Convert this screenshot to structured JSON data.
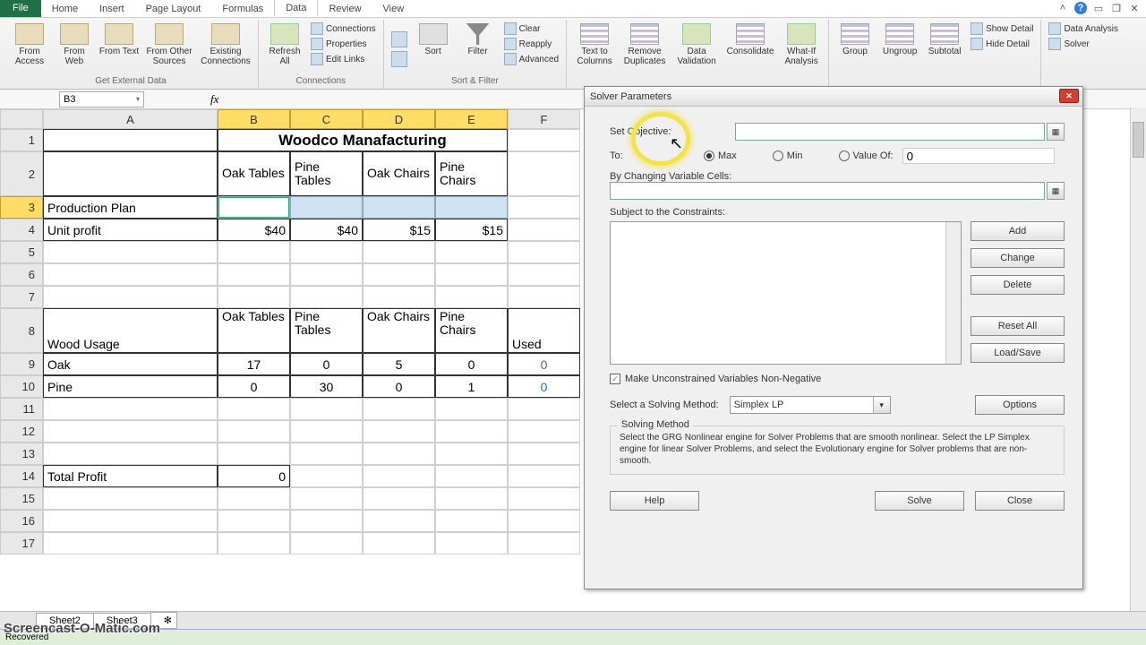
{
  "tabs": {
    "file": "File",
    "home": "Home",
    "insert": "Insert",
    "pagelayout": "Page Layout",
    "formulas": "Formulas",
    "data": "Data",
    "review": "Review",
    "view": "View"
  },
  "ribbon": {
    "ext": {
      "access": "From Access",
      "web": "From Web",
      "text": "From Text",
      "other": "From Other Sources",
      "existing": "Existing Connections",
      "group": "Get External Data"
    },
    "conn": {
      "refresh": "Refresh All",
      "connections": "Connections",
      "properties": "Properties",
      "editlinks": "Edit Links",
      "group": "Connections"
    },
    "sort": {
      "sort": "Sort",
      "filter": "Filter",
      "clear": "Clear",
      "reapply": "Reapply",
      "advanced": "Advanced",
      "group": "Sort & Filter"
    },
    "tools": {
      "ttc": "Text to Columns",
      "rmdup": "Remove Duplicates",
      "dvalid": "Data Validation",
      "consol": "Consolidate",
      "whatif": "What-If Analysis"
    },
    "outline": {
      "group": "Group",
      "ungroup": "Ungroup",
      "subtotal": "Subtotal",
      "show": "Show Detail",
      "hide": "Hide Detail"
    },
    "analysis": {
      "da": "Data Analysis",
      "solver": "Solver"
    }
  },
  "namebox": "B3",
  "cols": [
    "A",
    "B",
    "C",
    "D",
    "E",
    "F"
  ],
  "rows": [
    "1",
    "2",
    "3",
    "4",
    "5",
    "6",
    "7",
    "8",
    "9",
    "10",
    "11",
    "12",
    "13",
    "14",
    "15",
    "16",
    "17"
  ],
  "cells": {
    "title": "Woodco Manafacturing",
    "hdr": {
      "b2": "Oak Tables",
      "c2": "Pine Tables",
      "d2": "Oak Chairs",
      "e2": "Pine Chairs"
    },
    "a3": "Production Plan",
    "a4": "Unit profit",
    "b4": "$40",
    "c4": "$40",
    "d4": "$15",
    "e4": "$15",
    "a8": "Wood Usage",
    "b8": "Oak Tables",
    "c8": "Pine Tables",
    "d8": "Oak Chairs",
    "e8": "Pine Chairs",
    "f8": "Used",
    "a9": "Oak",
    "b9": "17",
    "c9": "0",
    "d9": "5",
    "e9": "0",
    "f9": "0",
    "a10": "Pine",
    "b10": "0",
    "c10": "30",
    "d10": "0",
    "e10": "1",
    "f10": "0",
    "a14": "Total Profit",
    "b14": "0"
  },
  "solver": {
    "title": "Solver Parameters",
    "setobj": "Set Objective:",
    "to": "To:",
    "max": "Max",
    "min": "Min",
    "valueof": "Value Of:",
    "val0": "0",
    "bychanging": "By Changing Variable Cells:",
    "subject": "Subject to the Constraints:",
    "add": "Add",
    "change": "Change",
    "delete": "Delete",
    "resetall": "Reset All",
    "loadsave": "Load/Save",
    "options": "Options",
    "nonneg": "Make Unconstrained Variables Non-Negative",
    "selmethod": "Select a Solving Method:",
    "method": "Simplex LP",
    "mbox_title": "Solving Method",
    "mbox_desc": "Select the GRG Nonlinear engine for Solver Problems that are smooth nonlinear. Select the LP Simplex engine for linear Solver Problems, and select the Evolutionary engine for Solver problems that are non-smooth.",
    "help": "Help",
    "solve": "Solve",
    "close": "Close"
  },
  "sheets": {
    "s2": "Sheet2",
    "s3": "Sheet3"
  },
  "status": {
    "recovered": "Recovered"
  },
  "watermark": "Screencast-O-Matic.com",
  "chart_data": {
    "type": "table",
    "title": "Woodco Manafacturing",
    "production_headers": [
      "Oak Tables",
      "Pine Tables",
      "Oak Chairs",
      "Pine Chairs"
    ],
    "unit_profit": [
      40,
      40,
      15,
      15
    ],
    "wood_usage": {
      "headers": [
        "Oak Tables",
        "Pine Tables",
        "Oak Chairs",
        "Pine Chairs",
        "Used"
      ],
      "Oak": [
        17,
        0,
        5,
        0,
        0
      ],
      "Pine": [
        0,
        30,
        0,
        1,
        0
      ]
    },
    "total_profit": 0
  }
}
